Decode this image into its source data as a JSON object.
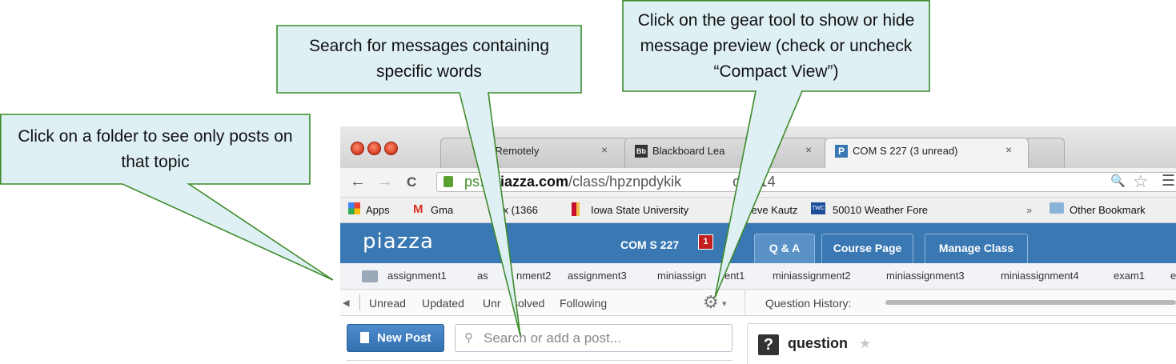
{
  "browser": {
    "tabs": [
      {
        "title": "king Remotely",
        "close": "×"
      },
      {
        "title": "Blackboard Lea",
        "close": "×",
        "favicon_text": "Bb"
      },
      {
        "title": "COM S 227 (3 unread)",
        "close": "×",
        "favicon_text": "P"
      }
    ],
    "address": {
      "scheme_fragment": "ps://",
      "host": "piazza.com",
      "path": "/class/hpznpdykik",
      "query_fragment": "cid=14"
    },
    "nav": {
      "back": "←",
      "forward": "→",
      "reload": "C",
      "zoom": "🔍",
      "star": "☆",
      "menu": "☰"
    },
    "bookmarks": [
      {
        "label": "Apps"
      },
      {
        "label": "Gma"
      },
      {
        "label": "box (1366"
      },
      {
        "label": "Iowa State University"
      },
      {
        "label": "teve Kautz"
      },
      {
        "label": "50010 Weather Fore",
        "icon_text": "TWC"
      }
    ],
    "bookmarks_overflow": "»",
    "other_bookmarks": "Other Bookmark"
  },
  "piazza": {
    "logo": "piazza",
    "course": "COM S 227",
    "unread_badge": "1",
    "tabs": [
      "Q & A",
      "Course Page",
      "Manage Class"
    ],
    "folders": [
      "assignment1",
      "as",
      "nment2",
      "assignment3",
      "miniassign",
      "ent1",
      "miniassignment2",
      "miniassignment3",
      "miniassignment4",
      "exam1",
      "e"
    ],
    "filters": [
      "Unread",
      "Updated",
      "Unr",
      "solved",
      "Following"
    ],
    "collapse_arrow": "◀",
    "gear_caret": "▾",
    "question_history_label": "Question History:",
    "new_post_label": "New Post",
    "search_text": "Search or add a post...",
    "question": {
      "title": "question",
      "icon": "?",
      "star": "★"
    }
  },
  "callouts": {
    "folder": "Click on a folder to see only posts on that topic",
    "search": "Search for messages containing specific words",
    "gear": "Click on the gear tool to show or hide message preview (check or uncheck “Compact View”)"
  },
  "colors": {
    "callout_fill": "#dff0f5",
    "callout_border": "#3d8b2a",
    "piazza_blue": "#3a78b4",
    "badge_red": "#c41f1f"
  }
}
